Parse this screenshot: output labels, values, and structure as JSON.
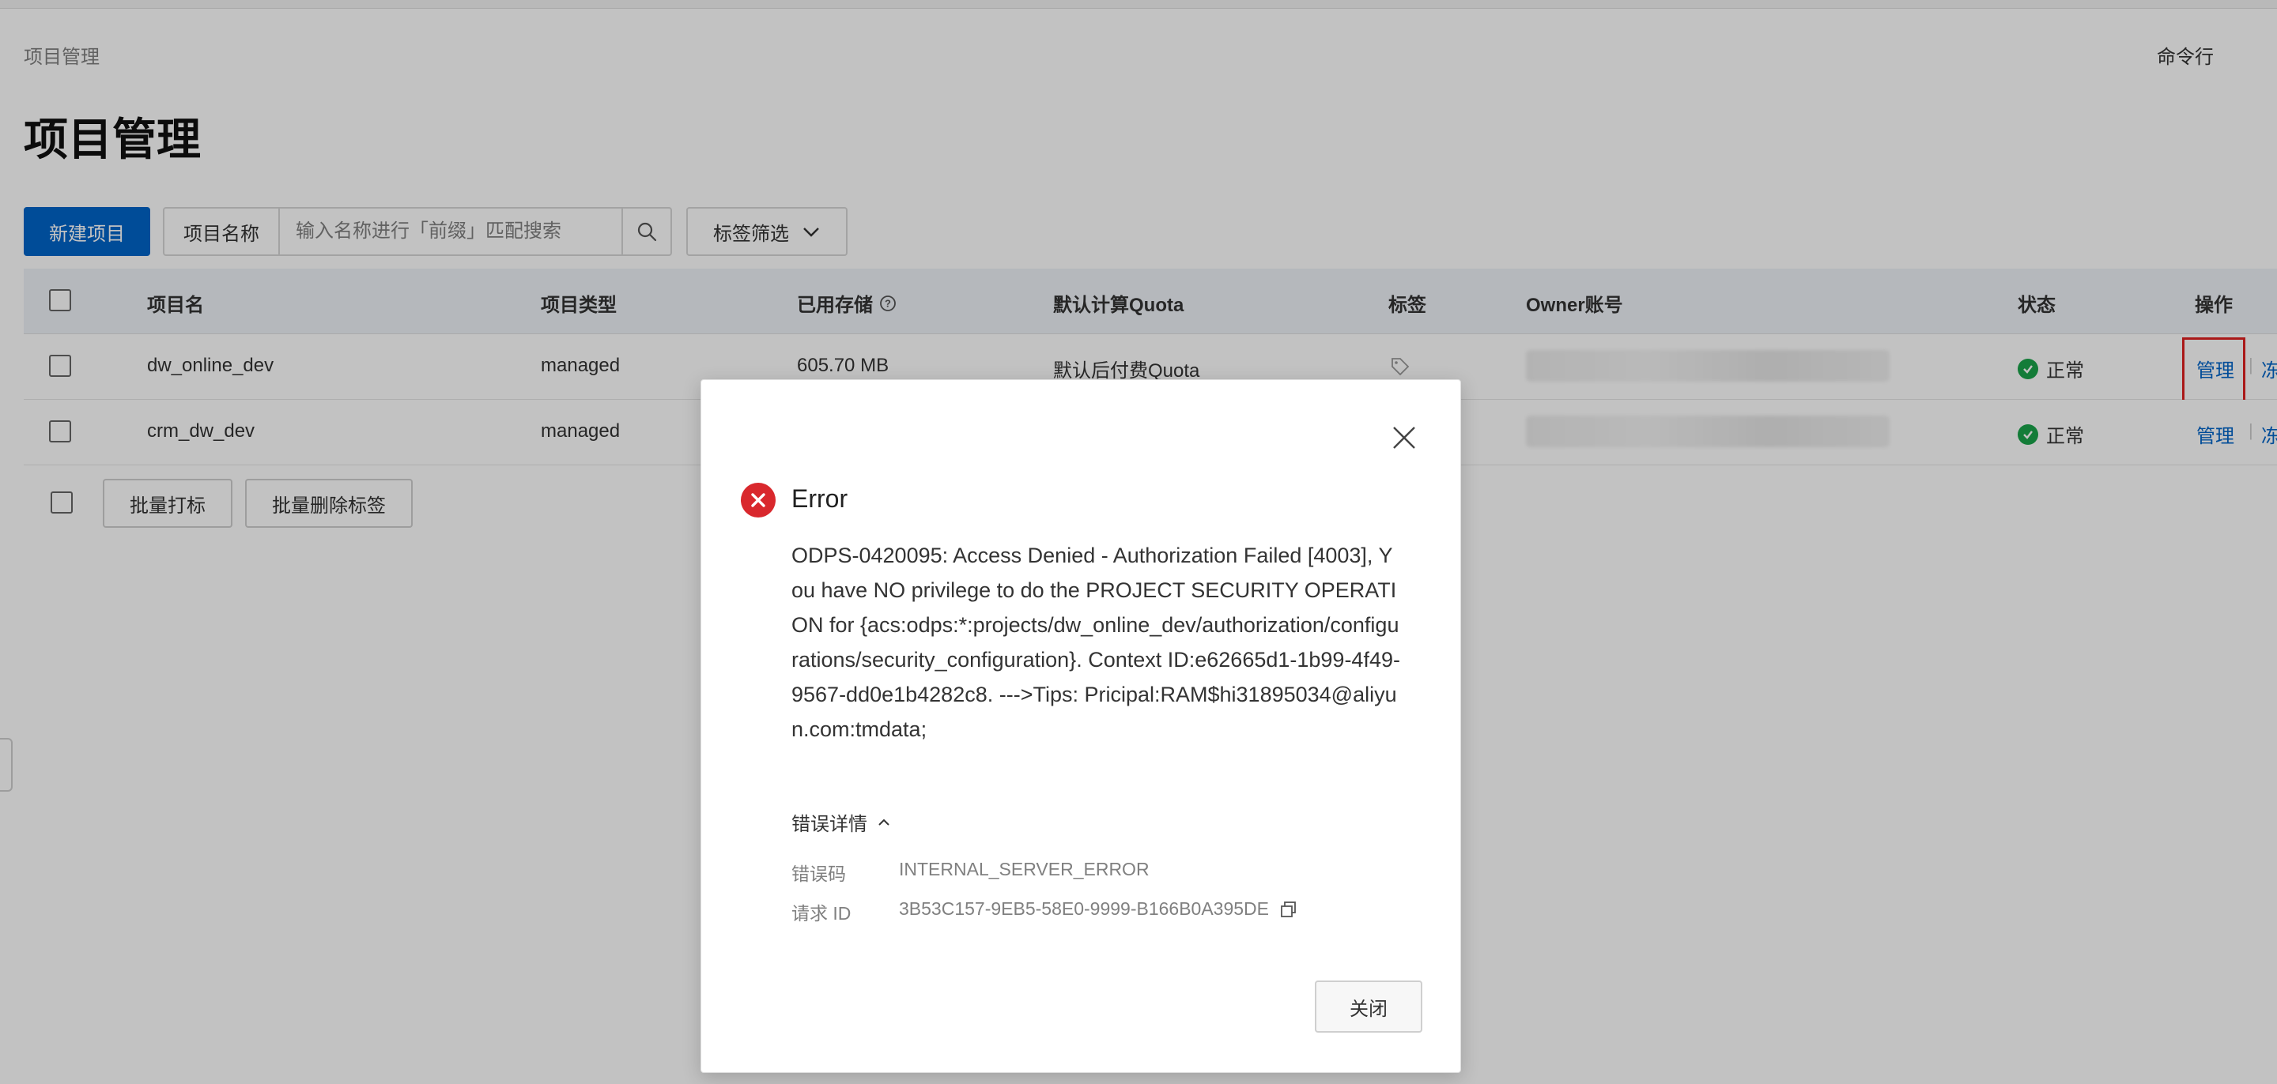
{
  "header": {
    "breadcrumb": "项目管理",
    "command_line": "命令行",
    "page_title": "项目管理"
  },
  "toolbar": {
    "new_project": "新建项目",
    "search_label": "项目名称",
    "search_placeholder": "输入名称进行「前缀」匹配搜索",
    "tag_filter": "标签筛选"
  },
  "table": {
    "columns": [
      "项目名",
      "项目类型",
      "已用存储",
      "默认计算Quota",
      "标签",
      "Owner账号",
      "状态",
      "操作"
    ],
    "rows": [
      {
        "name": "dw_online_dev",
        "type": "managed",
        "storage": "605.70 MB",
        "quota": "默认后付费Quota",
        "status": "正常",
        "action_manage": "管理",
        "action_more": "冻"
      },
      {
        "name": "crm_dw_dev",
        "type": "managed",
        "storage": "",
        "quota": "",
        "status": "正常",
        "action_manage": "管理",
        "action_more": "冻"
      }
    ],
    "batch_tag": "批量打标",
    "batch_delete_tag": "批量删除标签"
  },
  "modal": {
    "title": "Error",
    "message": "ODPS-0420095: Access Denied - Authorization Failed [4003], You have NO privilege to do the PROJECT SECURITY OPERATION for {acs:odps:*:projects/dw_online_dev/authorization/configurations/security_configuration}. Context ID:e62665d1-1b99-4f49-9567-dd0e1b4282c8. --->Tips: Pricipal:RAM$hi31895034@aliyun.com:tmdata;",
    "details_label": "错误详情",
    "error_code_label": "错误码",
    "error_code": "INTERNAL_SERVER_ERROR",
    "request_id_label": "请求 ID",
    "request_id": "3B53C157-9EB5-58E0-9999-B166B0A395DE",
    "close_button": "关闭"
  },
  "colors": {
    "primary": "#0064c8",
    "error": "#d9282d",
    "success": "#1aa34a",
    "highlight": "#e02020"
  }
}
